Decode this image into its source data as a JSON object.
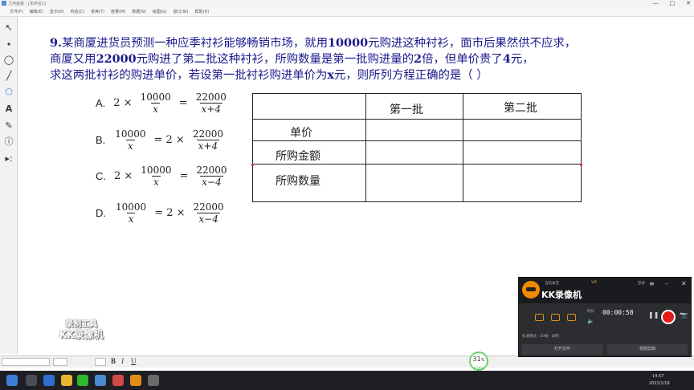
{
  "window": {
    "title": "几何画板 - [未命名1]",
    "controls": [
      "—",
      "□",
      "✕"
    ]
  },
  "menu": [
    "文件(F)",
    "编辑(E)",
    "显示(D)",
    "构造(C)",
    "变换(T)",
    "度量(M)",
    "数据(N)",
    "绘图(G)",
    "窗口(W)",
    "帮助(H)"
  ],
  "tools": [
    "arrow",
    "point",
    "compass",
    "straightedge",
    "polygon",
    "text",
    "marker",
    "info",
    "custom"
  ],
  "tool_glyphs": [
    "↖",
    "•",
    "◯",
    "╱",
    "⬠",
    "A",
    "✎",
    "ⓘ",
    "▸:"
  ],
  "question": {
    "line1_num": "9.",
    "line1_a": "某商厦进货员预测一种应季衬衫能够畅销市场，就用",
    "line1_b": "10000",
    "line1_c": "元购进这种衬衫，面市后果然供不应求，",
    "line2_a": "商厦又用",
    "line2_b": "22000",
    "line2_c": "元购进了第二批这种衬衫，所购数量是第一批购进量的",
    "line2_d": "2",
    "line2_e": "倍，但单价贵了",
    "line2_f": "4",
    "line2_g": "元，",
    "line3_a": "求这两批衬衫的购进单价，若设第一批衬衫购进单价为",
    "line3_b": "x",
    "line3_c": "元，则所列方程正确的是（    ）"
  },
  "options": [
    {
      "letter": "A.",
      "left_coef": "2 ×",
      "n1": "10000",
      "d1": "x",
      "eq": "=",
      "right_coef": "",
      "n2": "22000",
      "d2": "x+4"
    },
    {
      "letter": "B.",
      "left_coef": "",
      "n1": "10000",
      "d1": "x",
      "eq": "= 2 ×",
      "right_coef": "",
      "n2": "22000",
      "d2": "x+4"
    },
    {
      "letter": "C.",
      "left_coef": "2 ×",
      "n1": "10000",
      "d1": "x",
      "eq": "=",
      "right_coef": "",
      "n2": "22000",
      "d2": "x−4"
    },
    {
      "letter": "D.",
      "left_coef": "",
      "n1": "10000",
      "d1": "x",
      "eq": "= 2 ×",
      "right_coef": "",
      "n2": "22000",
      "d2": "x−4"
    }
  ],
  "table": {
    "col_headers": [
      "第一批",
      "第二批"
    ],
    "row_headers": [
      "单价",
      "所购金额",
      "所购数量"
    ]
  },
  "watermark": {
    "line1": "录制工具",
    "line2": "KK录像机"
  },
  "formatbar": {
    "bold": "B",
    "italic": "I",
    "underline": "U"
  },
  "counter": {
    "value": "31",
    "unit": "%",
    "sub": "0.1K/s"
  },
  "recorder": {
    "name": "KK录像机",
    "label_top": "当前录音",
    "vip": "VIP",
    "upgrade": "登录",
    "timer": "00:00:58",
    "timer_label": "时长",
    "quality": "标清模式 · 30帧 · 录制",
    "btn_left": "打开文件",
    "btn_right": "视频剪辑"
  },
  "taskbar": {
    "time": "14:57",
    "date": "2021/1/18"
  },
  "colors": {
    "question_text": "#1a1a8c",
    "table_line": "#222222",
    "record": "#e41c1c",
    "kk_accent": "#f08a00"
  }
}
